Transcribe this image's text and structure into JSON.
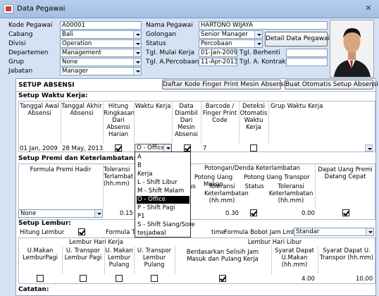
{
  "window": {
    "title": "Data Pegawai"
  },
  "form": {
    "kode_pegawai": {
      "label": "Kode Pegawai",
      "value": "A00001"
    },
    "cabang": {
      "label": "Cabang",
      "value": "Bali"
    },
    "divisi": {
      "label": "Divisi",
      "value": "Operation"
    },
    "departemen": {
      "label": "Departemen",
      "value": "Management"
    },
    "grup": {
      "label": "Grup",
      "value": "None"
    },
    "jabatan": {
      "label": "Jabatan",
      "value": "Manager"
    },
    "nama_pegawai": {
      "label": "Nama Pegawai",
      "value": "HARTONO WIJAYA"
    },
    "golongan": {
      "label": "Golongan",
      "value": "Senior Manager"
    },
    "status": {
      "label": "Status",
      "value": "Percobaan"
    },
    "tgl_mulai_kerja": {
      "label": "Tgl. Mulai Kerja",
      "value": "01-Jan-2009"
    },
    "tgl_percobaan": {
      "label": "Tgl. A.Percobaan",
      "value": "11-Apr-2013"
    },
    "tgl_berhenti": {
      "label": "Tgl. Berhenti",
      "value": ""
    },
    "tgl_kontrak": {
      "label": "Tgl. A. Kontrak",
      "value": ""
    },
    "detail_button": "Detail Data Pegawai"
  },
  "absensi": {
    "title": "SETUP ABSENSI",
    "btn_finger": "Daftar Kode Finger Print Mesin Absensi",
    "btn_auto": "Buat Otomatis Setup Absensi",
    "waktu_title": "Setup Waktu Kerja:",
    "headers": {
      "tgl_awal": "Tanggal Awal Absensi",
      "tgl_akhir": "Tanggal Akhir Absensi",
      "hitung": "Hitung Ringkasan Dari Absensi Harian",
      "waktu": "Waktu Kerja",
      "data_mesin": "Data Diambil Dari Mesin Absensi",
      "barcode": "Barcode / Finger Print Code",
      "deteksi": "Deteksi Otomatis Waktu Kerja",
      "grup_waktu": "Grup Waktu Kerja"
    },
    "row": {
      "tgl_awal": "01 Jan, 2009",
      "tgl_akhir": "28 May, 2013",
      "waktu": "O  - Office",
      "barcode": "7"
    }
  },
  "dropdown": {
    "items": [
      "A",
      "B",
      "Kerja",
      "L  - Shift Libur",
      "M  - Shift Malam",
      "O  - Office",
      "P  - Shift Pagi",
      "P1",
      "S  - Shift Siang/Sore",
      "tesjadwal"
    ],
    "selected_index": 5
  },
  "premi": {
    "title": "Setup Premi dan Keterlambatan:",
    "formula_hadir": "Formula Premi Hadir",
    "toleransi": "Toleransi Terlambat (hh.mm)",
    "potongan_title": "Potongan/Denda Keterlambatan",
    "uang_makan": "Potong Uang Makan",
    "uang_transpor": "Potong Uang Transpor",
    "status_partial": "us",
    "toleransi_ket": "Toleransi Keterlambatan (hh.mm)",
    "status": "Status",
    "toleransi_ket2": "Toleransi Keterlambatan (hh.mm)",
    "dapat_uang": "Dapat Uang Premi Datang Cepat",
    "row": {
      "formula": "None",
      "toleransi": "0.15",
      "tol_makan": "0.30",
      "tol_transpor": "0.00"
    }
  },
  "lembur": {
    "title": "Setup Lembur:",
    "hitung": "Hitung Lembur",
    "formula_t": "Formula T",
    "overtime_partial": "time",
    "formula_bobot": "Formula Bobot Jam Lmbr",
    "formula_bobot_value": "Standar",
    "hari_kerja": "Lembur Hari Kerja",
    "hari_libur": "Lembur Hari Libur",
    "h1": "U.Makan LemburPagi",
    "h2": "U. Transpor Lembur Pagi",
    "h3": "U. Makan Lembur Pulang",
    "h4": "U. Transpor Lembur Pulang",
    "h5": "Berdasarkan Selisih Jam Masuk dan Pulang Kerja",
    "h6": "Syarat Dapat U.Makan (hh.mm)",
    "h7": "Syarat Dapat U. Transpor (hh.mm)",
    "row": {
      "syarat_makan": "4.00",
      "syarat_transpor": "10.00"
    }
  },
  "catatan": {
    "label": "Catatan:"
  }
}
